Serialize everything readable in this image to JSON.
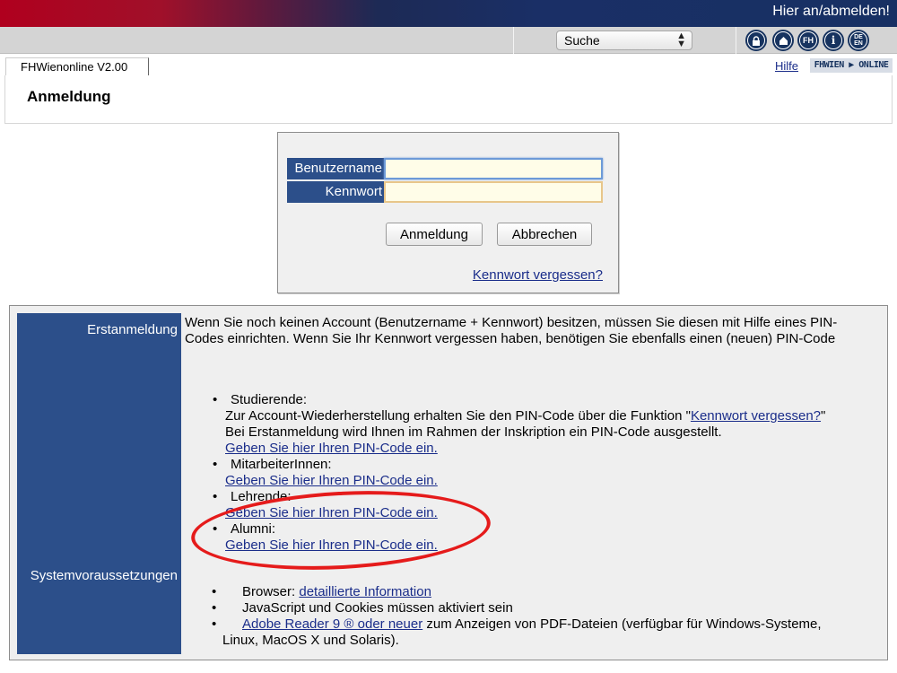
{
  "topbar": {
    "login_link": "Hier an/abmelden!"
  },
  "toolbar": {
    "search_select": {
      "value": "Suche",
      "arrows": "▲▼"
    },
    "icons": [
      {
        "name": "lock-icon",
        "glyph": "🔒"
      },
      {
        "name": "home-icon",
        "glyph": "⌂"
      },
      {
        "name": "fh-icon",
        "glyph": "FH"
      },
      {
        "name": "info-icon",
        "glyph": "i"
      },
      {
        "name": "language-icon",
        "glyph": "DE EN"
      }
    ]
  },
  "tabrow": {
    "tab_label": "FHWienonline V2.00",
    "help_link": "Hilfe",
    "brand": "FHWIEN ▶ ONLINE"
  },
  "page": {
    "title": "Anmeldung"
  },
  "login": {
    "username_label": "Benutzername",
    "password_label": "Kennwort",
    "username_value": "",
    "password_value": "",
    "login_button": "Anmeldung",
    "cancel_button": "Abbrechen",
    "forgot_link": "Kennwort vergessen?"
  },
  "info": {
    "first_login_label": "Erstanmeldung",
    "system_requirements_label": "Systemvoraussetzungen",
    "intro_text": "Wenn Sie noch keinen Account (Benutzername + Kennwort) besitzen, müssen Sie diesen mit Hilfe eines PIN-Codes einrichten. Wenn Sie Ihr Kennwort vergessen haben, benötigen Sie ebenfalls einen (neuen) PIN-Code",
    "students": {
      "title": "Studierende:",
      "line1_prefix": "Zur Account-Wiederherstellung erhalten Sie den PIN-Code über die Funktion \"",
      "line1_link": "Kennwort vergessen?",
      "line1_suffix": "\"",
      "line2": "Bei Erstanmeldung wird Ihnen im Rahmen der Inskription ein PIN-Code ausgestellt.",
      "pin_link": "Geben Sie hier Ihren PIN-Code ein."
    },
    "staff": {
      "title": "MitarbeiterInnen:",
      "pin_link": "Geben Sie hier Ihren PIN-Code ein."
    },
    "teachers": {
      "title": "Lehrende:",
      "pin_link": "Geben Sie hier Ihren PIN-Code ein."
    },
    "alumni": {
      "title": "Alumni:",
      "pin_link": "Geben Sie hier Ihren PIN-Code ein."
    },
    "requirements": {
      "browser_prefix": "Browser: ",
      "browser_link": "detaillierte Information",
      "js_cookies": "JavaScript und Cookies müssen aktiviert sein",
      "adobe_link": "Adobe Reader 9 ® oder neuer",
      "adobe_suffix": " zum Anzeigen von PDF-Dateien (verfügbar für Windows-Systeme,",
      "adobe_line2": "Linux, MacOS X und Solaris)."
    }
  },
  "colors": {
    "accent_blue": "#2c4f8a",
    "link": "#1a2d8a",
    "highlight_red": "#e51b1b"
  }
}
